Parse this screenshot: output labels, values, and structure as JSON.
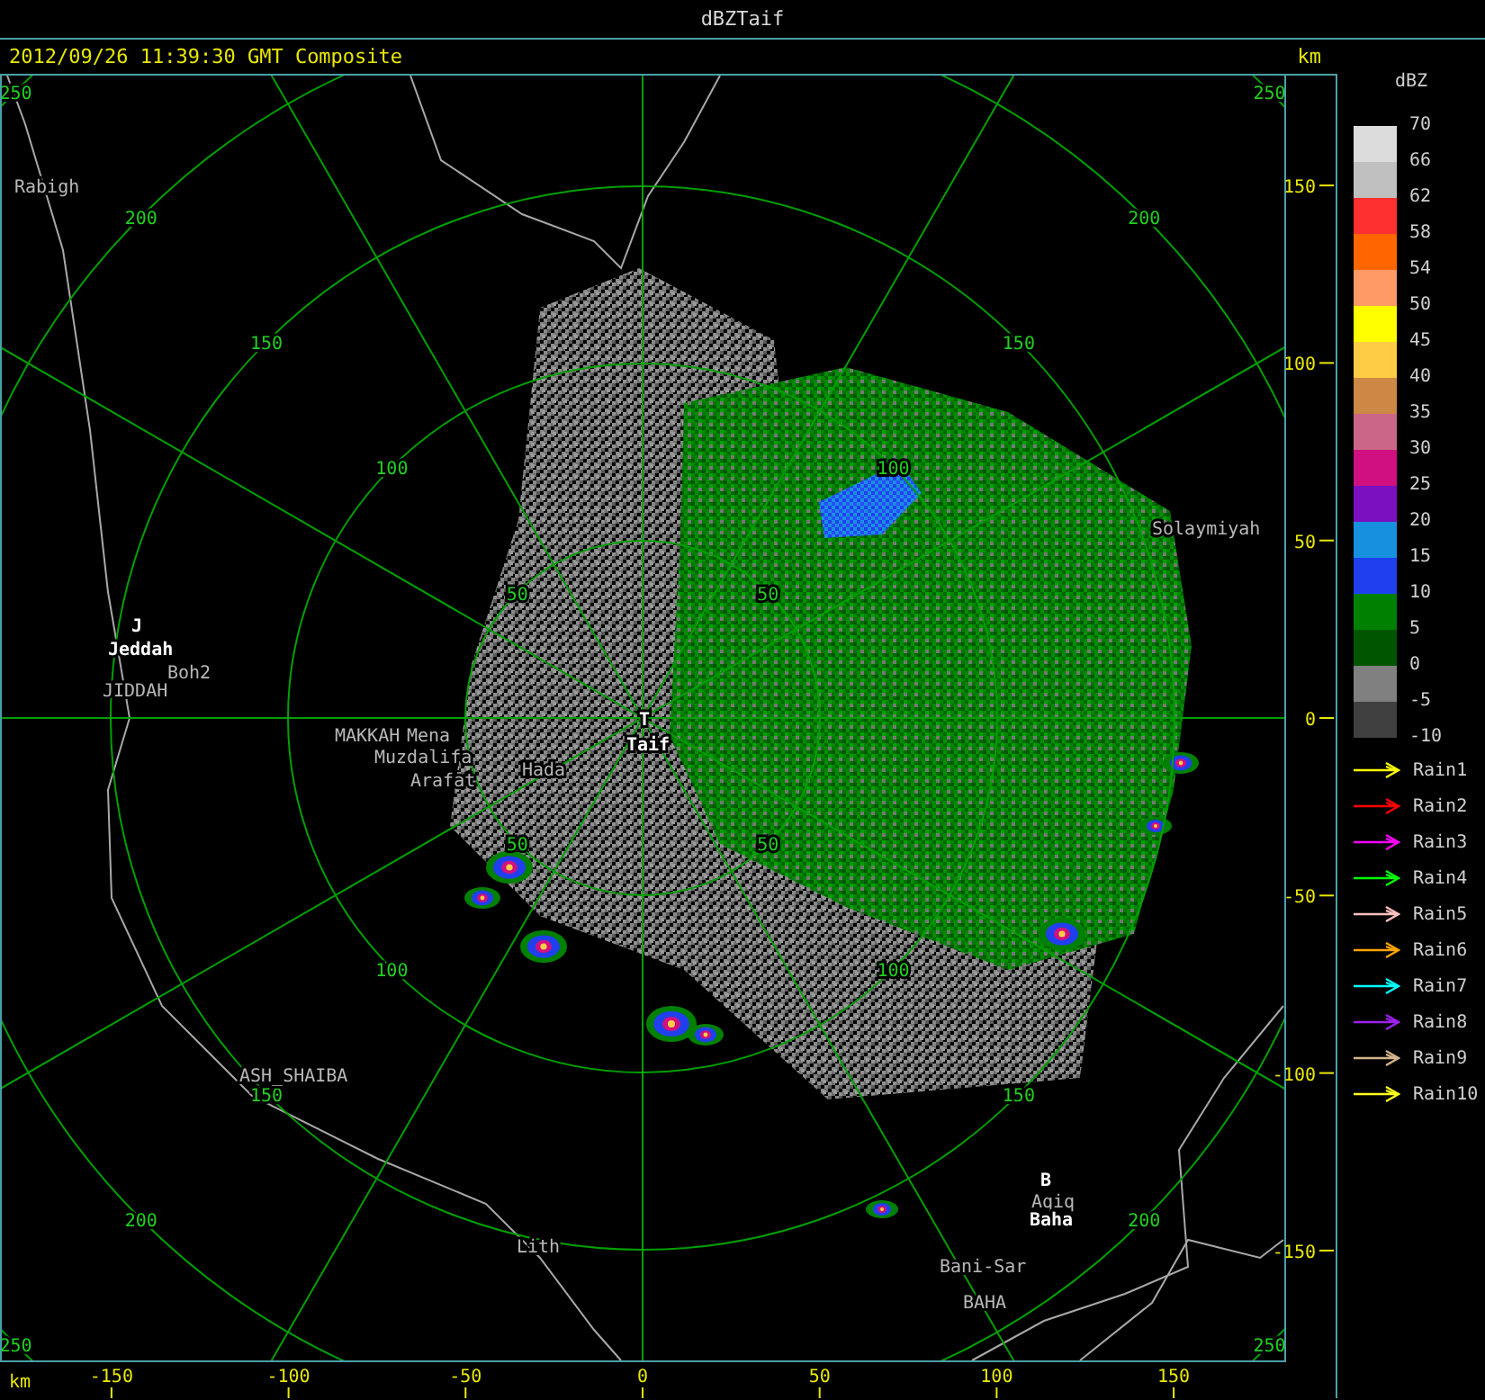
{
  "window": {
    "title": "dBZTaif"
  },
  "header": {
    "timestamp": "2012/09/26 11:39:30 GMT Composite",
    "unit": "km"
  },
  "map": {
    "ring_labels": [
      [
        "50",
        "100",
        "150",
        "200",
        "250"
      ],
      [
        "50",
        "100",
        "150",
        "200",
        "250"
      ],
      [
        "50",
        "100",
        "150",
        "200",
        "250"
      ],
      [
        "50",
        "100",
        "150",
        "200",
        "250"
      ]
    ],
    "places": [
      {
        "name": "Rabigh",
        "kind": "site"
      },
      {
        "name": "J",
        "kind": "marker"
      },
      {
        "name": "Jeddah",
        "kind": "city"
      },
      {
        "name": "Boh2",
        "kind": "site"
      },
      {
        "name": "JIDDAH",
        "kind": "site"
      },
      {
        "name": "MAKKAH",
        "kind": "site"
      },
      {
        "name": "Mena",
        "kind": "site"
      },
      {
        "name": "Muzdalifa",
        "kind": "site"
      },
      {
        "name": "Arafat",
        "kind": "site"
      },
      {
        "name": "Hada",
        "kind": "site"
      },
      {
        "name": "T",
        "kind": "marker"
      },
      {
        "name": "Taif",
        "kind": "city"
      },
      {
        "name": "Solaymiyah",
        "kind": "site"
      },
      {
        "name": "ASH_SHAIBA",
        "kind": "site"
      },
      {
        "name": "Lith",
        "kind": "site"
      },
      {
        "name": "B",
        "kind": "marker"
      },
      {
        "name": "Aqiq",
        "kind": "site"
      },
      {
        "name": "Baha",
        "kind": "city"
      },
      {
        "name": "Bani-Sar",
        "kind": "site"
      },
      {
        "name": "BAHA",
        "kind": "site"
      }
    ]
  },
  "y_axis": {
    "ticks": [
      "150",
      "100",
      "50",
      "0",
      "-50",
      "-100",
      "-150"
    ]
  },
  "x_axis": {
    "unit": "km",
    "ticks": [
      "-150",
      "-100",
      "-50",
      "0",
      "50",
      "100",
      "150"
    ]
  },
  "legend": {
    "title": "dBZ",
    "bands": [
      {
        "color": "#dcdcdc"
      },
      {
        "color": "#c0c0c0"
      },
      {
        "color": "#ff3030"
      },
      {
        "color": "#ff6600"
      },
      {
        "color": "#ff9966"
      },
      {
        "color": "#ffff00"
      },
      {
        "color": "#ffcc44"
      },
      {
        "color": "#cc8844"
      },
      {
        "color": "#cc6688"
      },
      {
        "color": "#d01080"
      },
      {
        "color": "#7a10c0"
      },
      {
        "color": "#1890e0"
      },
      {
        "color": "#2040f0"
      },
      {
        "color": "#008000"
      },
      {
        "color": "#005500"
      },
      {
        "color": "#808080"
      },
      {
        "color": "#404040"
      }
    ],
    "levels": [
      "70",
      "66",
      "62",
      "58",
      "54",
      "50",
      "45",
      "40",
      "35",
      "30",
      "25",
      "20",
      "15",
      "10",
      "5",
      "0",
      "-5",
      "-10"
    ]
  },
  "rain_tracks": [
    {
      "label": "Rain1",
      "color": "#ffff00"
    },
    {
      "label": "Rain2",
      "color": "#ff0000"
    },
    {
      "label": "Rain3",
      "color": "#ff00ff"
    },
    {
      "label": "Rain4",
      "color": "#00ff00"
    },
    {
      "label": "Rain5",
      "color": "#ffc0c0"
    },
    {
      "label": "Rain6",
      "color": "#ffa500"
    },
    {
      "label": "Rain7",
      "color": "#00ffff"
    },
    {
      "label": "Rain8",
      "color": "#a020f0"
    },
    {
      "label": "Rain9",
      "color": "#d2b48c"
    },
    {
      "label": "Rain10",
      "color": "#ffff20"
    }
  ]
}
